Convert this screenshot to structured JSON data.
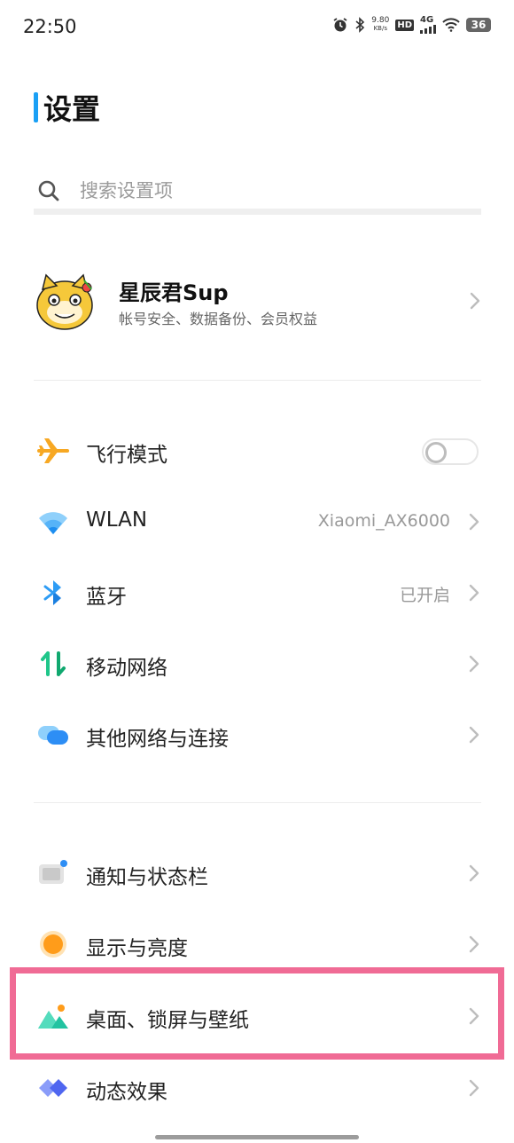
{
  "status_bar": {
    "time": "22:50",
    "speed_value": "9.80",
    "speed_unit": "KB/s",
    "hd": "HD",
    "network": "4G",
    "battery": "36"
  },
  "header": {
    "title": "设置"
  },
  "search": {
    "placeholder": "搜索设置项"
  },
  "profile": {
    "name": "星辰君Sup",
    "subtitle": "帐号安全、数据备份、会员权益"
  },
  "connectivity": [
    {
      "label": "飞行模式",
      "icon": "airplane-icon",
      "toggle": false
    },
    {
      "label": "WLAN",
      "icon": "wifi-icon",
      "value": "Xiaomi_AX6000"
    },
    {
      "label": "蓝牙",
      "icon": "bluetooth-icon",
      "value": "已开启"
    },
    {
      "label": "移动网络",
      "icon": "mobile-data-icon"
    },
    {
      "label": "其他网络与连接",
      "icon": "other-networks-icon"
    }
  ],
  "display": [
    {
      "label": "通知与状态栏",
      "icon": "notification-icon"
    },
    {
      "label": "显示与亮度",
      "icon": "brightness-icon"
    },
    {
      "label": "桌面、锁屏与壁纸",
      "icon": "wallpaper-icon",
      "highlighted": true
    },
    {
      "label": "动态效果",
      "icon": "animation-icon"
    }
  ],
  "colors": {
    "accent": "#1aa0f5",
    "highlight": "#f06b95",
    "airplane": "#f7a823",
    "wifi": "#2d9cf5",
    "mobile_data": "#1fc68a",
    "brightness": "#ff9c1a",
    "wallpaper": "#22c3a1"
  }
}
